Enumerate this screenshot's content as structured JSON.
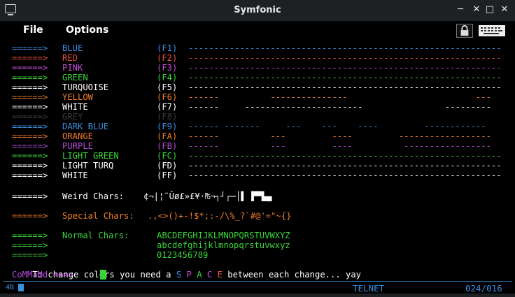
{
  "window": {
    "title": "Symfonic"
  },
  "menu": {
    "file": "File",
    "options": "Options"
  },
  "colors": {
    "blue": "#3b8fe0",
    "red": "#e8503a",
    "pink": "#c44fd6",
    "green": "#3ad43a",
    "turq": "#ffffff",
    "yellow": "#f07d2c",
    "white": "#ffffff",
    "grey": "#3a3a3a",
    "orange": "#f07d2c",
    "purple": "#b24ad4",
    "lightgreen": "#3ad43a"
  },
  "rows": [
    {
      "arrow": "======>",
      "name": "BLUE",
      "key": "(F1)",
      "line": "-------------------------------------------------------------",
      "color": "blue"
    },
    {
      "arrow": "======>",
      "name": "RED",
      "key": "(F2)",
      "line": "-------------------------------------------------------------",
      "color": "red"
    },
    {
      "arrow": "======>",
      "name": "PINK",
      "key": "(F3)",
      "line": "-------------------------------------------------------------",
      "color": "pink"
    },
    {
      "arrow": "======>",
      "name": "GREEN",
      "key": "(F4)",
      "line": "-------------------------------------------------------------",
      "color": "green"
    },
    {
      "arrow": "======>",
      "name": "TURQUOISE",
      "key": "(F5)",
      "line": "-------------------------------------------------------------",
      "color": "turq"
    },
    {
      "arrow": "======>",
      "name": "YELLOW",
      "key": "(F6)",
      "line": "------          ---------------                         ---",
      "color": "yellow"
    },
    {
      "arrow": "======>",
      "name": "WHITE",
      "key": "(F7)",
      "line": "------     -----------------------                ---------",
      "color": "white"
    },
    {
      "arrow": "======>",
      "name": "GREY",
      "key": "(F8)",
      "line": "",
      "color": "grey"
    },
    {
      "arrow": "======>",
      "name": "DARK BLUE",
      "key": "(F9)",
      "line": "------ -------     ---    ---    ----         ------------",
      "color": "blue"
    },
    {
      "arrow": "======>",
      "name": "ORANGE",
      "key": "(FA)",
      "line": "------          ---         ----         ------------------",
      "color": "orange"
    },
    {
      "arrow": "======>",
      "name": "PURPLE",
      "key": "(FB)",
      "line": "------          ---         ----          -----------------",
      "color": "purple"
    },
    {
      "arrow": "======>",
      "name": "LIGHT GREEN",
      "key": "(FC)",
      "line": "-------------------------------------------------------------",
      "color": "lightgreen"
    },
    {
      "arrow": "======>",
      "name": "LIGHT TURQ",
      "key": "(FD)",
      "line": "-------------------------------------------------------------",
      "color": "white"
    },
    {
      "arrow": "======>",
      "name": "WHITE",
      "key": "(FF)",
      "line": "-------------------------------------------------------------",
      "color": "white"
    }
  ],
  "weird": {
    "arrow": "======>",
    "label": "Weird Chars:",
    "chars": "¢¬|¦¨Ûø£»£¥·₧¬┐┘┌─│▌ ▛▀▙▄"
  },
  "special": {
    "arrow": "======>",
    "label": "Special Chars:",
    "chars": ".,<>()+-!$*;:-/\\%_?`#@'=\"~{}"
  },
  "normal": {
    "arrow": "======>",
    "label": "Normal Chars:",
    "upper": "ABCDEFGHIJKLMNOPQRSTUVWXYZ",
    "lower": "abcdefghijklmnopqrstuvwxyz",
    "digits": "0123456789"
  },
  "info": {
    "prefix": "To change colors you need a ",
    "space": "S P A C E",
    "suffix": " between each change... yay"
  },
  "command": {
    "prompt": "CoMMaNd ===>"
  },
  "status": {
    "left": "4B",
    "mode": "TELNET",
    "pos": "024/016"
  }
}
